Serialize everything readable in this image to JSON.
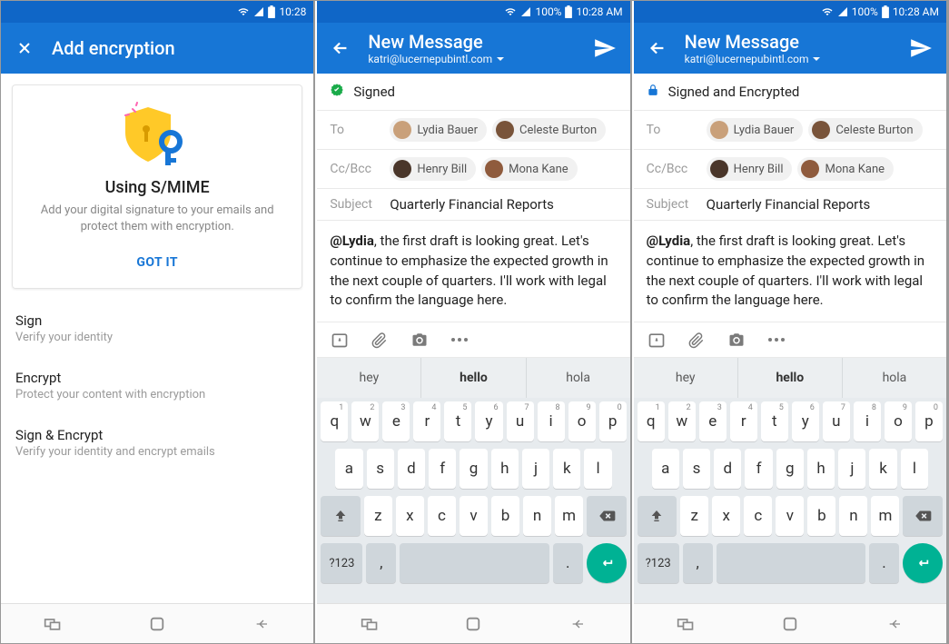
{
  "screens": {
    "settings": {
      "status_time": "10:28",
      "appbar_title": "Add encryption",
      "card": {
        "title": "Using S/MIME",
        "desc": "Add your digital signature to your emails and protect them with encryption.",
        "cta": "GOT IT"
      },
      "options": [
        {
          "title": "Sign",
          "sub": "Verify your identity"
        },
        {
          "title": "Encrypt",
          "sub": "Protect your content with encryption"
        },
        {
          "title": "Sign & Encrypt",
          "sub": "Verify your identity and encrypt emails"
        }
      ]
    },
    "compose": {
      "status_text": "100%",
      "status_time": "10:28 AM",
      "appbar_title": "New Message",
      "from_account": "katri@lucernepubintl.com",
      "to_label": "To",
      "cc_label": "Cc/Bcc",
      "subject_label": "Subject",
      "subject_value": "Quarterly Financial Reports",
      "recipients_to": [
        "Lydia Bauer",
        "Celeste Burton"
      ],
      "recipients_cc": [
        "Henry Bill",
        "Mona Kane"
      ],
      "body_mention": "@Lydia",
      "body_rest": ", the first draft is looking great. Let's continue to emphasize the expected growth in the next couple of quarters. I'll work with legal to confirm the language here.",
      "suggestions": [
        "hey",
        "hello",
        "hola"
      ],
      "keyboard": {
        "row1": [
          {
            "k": "q",
            "s": "1"
          },
          {
            "k": "w",
            "s": "2"
          },
          {
            "k": "e",
            "s": "3"
          },
          {
            "k": "r",
            "s": "4"
          },
          {
            "k": "t",
            "s": "5"
          },
          {
            "k": "y",
            "s": "6"
          },
          {
            "k": "u",
            "s": "7"
          },
          {
            "k": "i",
            "s": "8"
          },
          {
            "k": "o",
            "s": "9"
          },
          {
            "k": "p",
            "s": "0"
          }
        ],
        "row2": [
          "a",
          "s",
          "d",
          "f",
          "g",
          "h",
          "j",
          "k",
          "l"
        ],
        "row3": [
          "z",
          "x",
          "c",
          "v",
          "b",
          "n",
          "m"
        ],
        "sym": "?123",
        "comma": ",",
        "period": "."
      }
    },
    "signed_label": "Signed",
    "signed_encrypted_label": "Signed and Encrypted"
  }
}
